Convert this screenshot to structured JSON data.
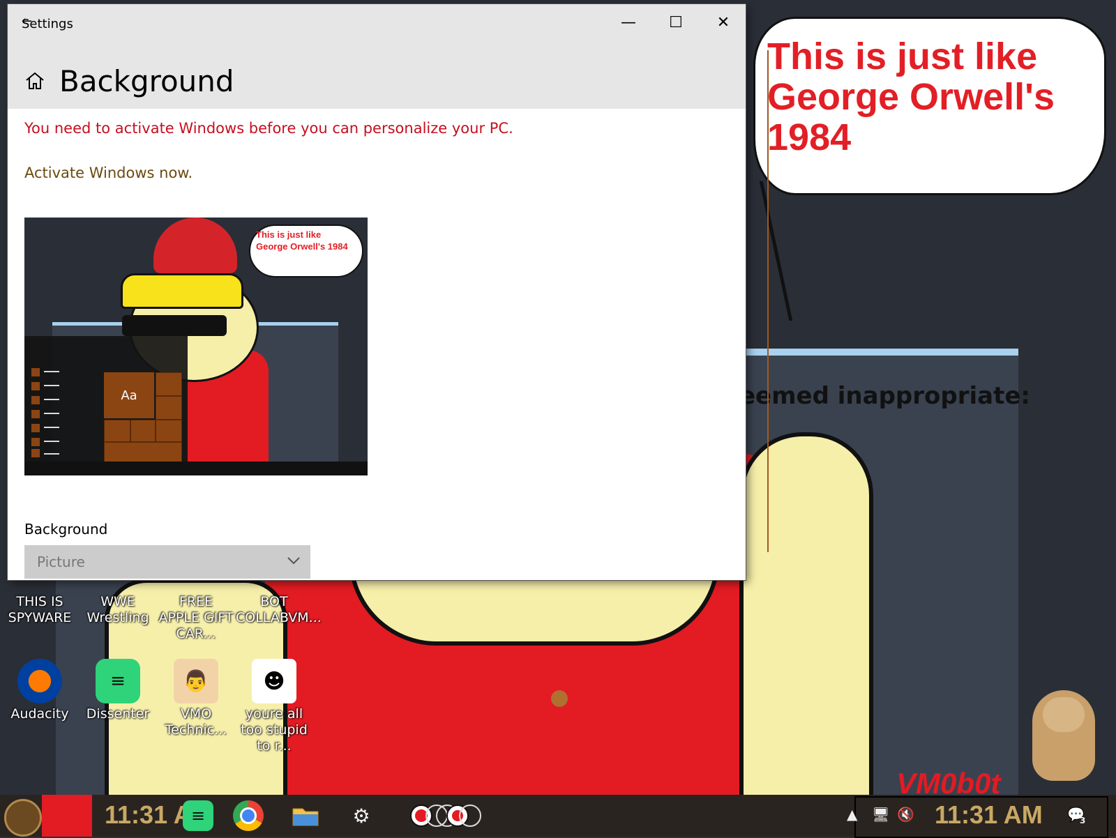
{
  "window": {
    "app_title": "Settings",
    "page_title": "Background",
    "activation_warning": "You need to activate Windows before you can personalize your PC.",
    "activate_link": "Activate Windows now.",
    "preview": {
      "bubble_text": "This is just like George Orwell's 1984",
      "tile_label": "Aa"
    },
    "background_label": "Background",
    "background_dropdown_value": "Picture",
    "controls": {
      "minimize": "—",
      "maximize": "☐",
      "close": "✕"
    }
  },
  "wallpaper": {
    "bubble_text": "This is just like George Orwell's 1984",
    "panel_text": "eemed inappropriate:",
    "watermark": "VM0b0t"
  },
  "desktop_icons": [
    {
      "label": "THIS IS SPYWARE"
    },
    {
      "label": "WWE Wrestling"
    },
    {
      "label": "FREE APPLE GIFT CAR..."
    },
    {
      "label": "BOT COLLABVM..."
    },
    {
      "label": "Audacity"
    },
    {
      "label": "Dissenter"
    },
    {
      "label": "VMO Technic..."
    },
    {
      "label": "youre all too stupid to r..."
    }
  ],
  "taskbar": {
    "clock_left": "11:31 AM",
    "clock_right": "11:31 AM",
    "notification_count": "3"
  },
  "colors": {
    "warning": "#c50f1f",
    "link": "#6b4a10",
    "clock": "#c9a865",
    "accent_red": "#e31b23"
  }
}
